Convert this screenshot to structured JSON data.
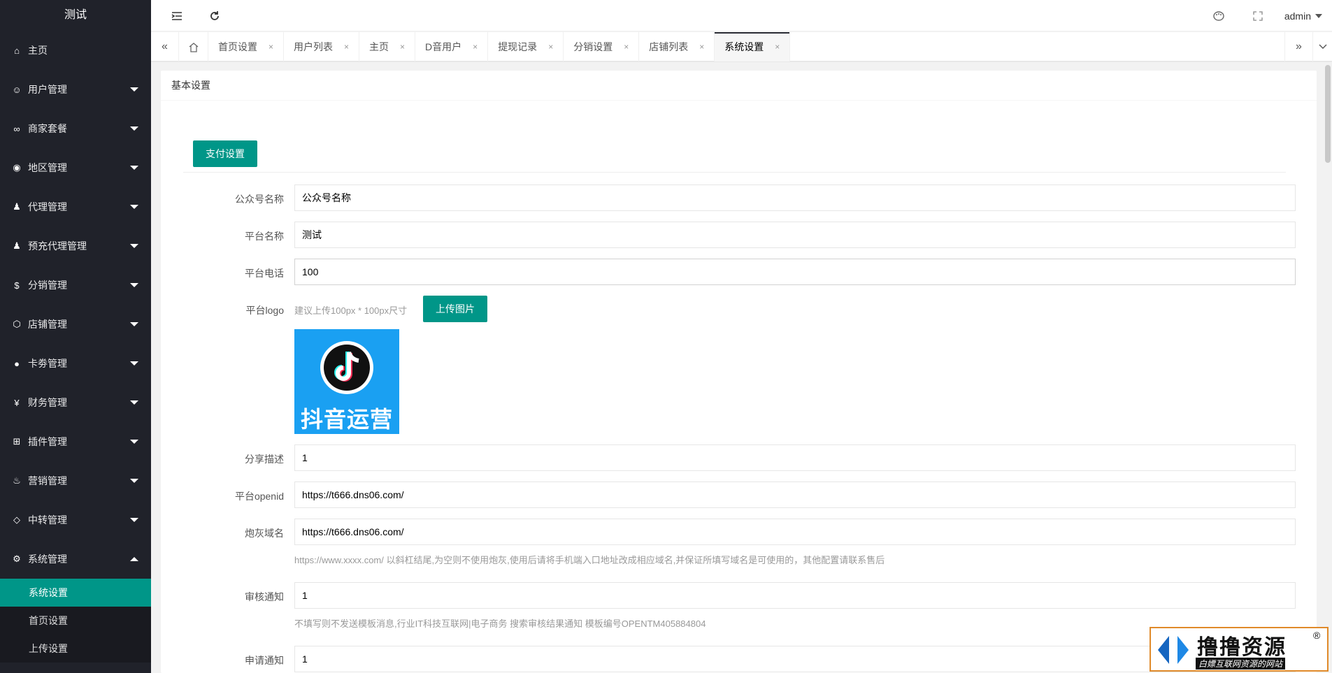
{
  "app": {
    "title": "测试"
  },
  "sidebar": {
    "items": [
      {
        "label": "主页",
        "icon": "home-icon",
        "glyph": "⌂",
        "has_caret": false
      },
      {
        "label": "用户管理",
        "icon": "user-icon",
        "glyph": "☺",
        "has_caret": true
      },
      {
        "label": "商家套餐",
        "icon": "link-icon",
        "glyph": "∞",
        "has_caret": true
      },
      {
        "label": "地区管理",
        "icon": "compass-icon",
        "glyph": "◉",
        "has_caret": true
      },
      {
        "label": "代理管理",
        "icon": "person-icon",
        "glyph": "♟",
        "has_caret": true
      },
      {
        "label": "预充代理管理",
        "icon": "person-icon",
        "glyph": "♟",
        "has_caret": true
      },
      {
        "label": "分销管理",
        "icon": "dollar-icon",
        "glyph": "$",
        "has_caret": true
      },
      {
        "label": "店铺管理",
        "icon": "box-icon",
        "glyph": "⬡",
        "has_caret": true
      },
      {
        "label": "卡劵管理",
        "icon": "circle-icon",
        "glyph": "●",
        "has_caret": true
      },
      {
        "label": "财务管理",
        "icon": "yen-icon",
        "glyph": "¥",
        "has_caret": true
      },
      {
        "label": "插件管理",
        "icon": "plugin-icon",
        "glyph": "⊞",
        "has_caret": true
      },
      {
        "label": "营销管理",
        "icon": "fire-icon",
        "glyph": "♨",
        "has_caret": true
      },
      {
        "label": "中转管理",
        "icon": "diamond-icon",
        "glyph": "◇",
        "has_caret": true
      },
      {
        "label": "系统管理",
        "icon": "gear-icon",
        "glyph": "⚙",
        "has_caret": true,
        "expanded": true
      }
    ],
    "sub_items": [
      "系统设置",
      "首页设置",
      "上传设置"
    ]
  },
  "header": {
    "user": "admin"
  },
  "tabs": [
    {
      "label": "首页设置"
    },
    {
      "label": "用户列表"
    },
    {
      "label": "主页"
    },
    {
      "label": "D音用户"
    },
    {
      "label": "提现记录"
    },
    {
      "label": "分销设置"
    },
    {
      "label": "店铺列表"
    },
    {
      "label": "系统设置",
      "active": true
    }
  ],
  "tab_close_glyph": "×",
  "card": {
    "title": "基本设置"
  },
  "form": {
    "section_button": "支付设置",
    "fields": {
      "wechat_name": {
        "label": "公众号名称",
        "value": "公众号名称"
      },
      "platform_name": {
        "label": "平台名称",
        "value": "测试"
      },
      "platform_phone": {
        "label": "平台电话",
        "value": "100"
      },
      "platform_logo": {
        "label": "平台logo",
        "hint": "建议上传100px * 100px尺寸",
        "button": "上传图片",
        "image_text": "抖音运营"
      },
      "share_desc": {
        "label": "分享描述",
        "value": "1"
      },
      "platform_openid": {
        "label": "平台openid",
        "value": "https://t666.dns06.com/"
      },
      "cannon_domain": {
        "label": "炮灰域名",
        "value": "https://t666.dns06.com/",
        "hint": "https://www.xxxx.com/ 以斜杠结尾,为空则不使用炮灰,使用后请将手机端入口地址改成相应域名,并保证所填写域名是可使用的，其他配置请联系售后"
      },
      "audit_notice": {
        "label": "审核通知",
        "value": "1",
        "hint": "不填写则不发送模板消息,行业IT科技互联网|电子商务 搜索审核结果通知 模板编号OPENTM405884804"
      },
      "apply_notice": {
        "label": "申请通知",
        "value": "1"
      }
    }
  },
  "watermark": {
    "text": "撸撸资源",
    "subtext": "白嫖互联网资源的网站",
    "mark": "®"
  },
  "colors": {
    "accent": "#009688",
    "sidebar": "#20222a",
    "logo_bg": "#1aa0f2"
  }
}
